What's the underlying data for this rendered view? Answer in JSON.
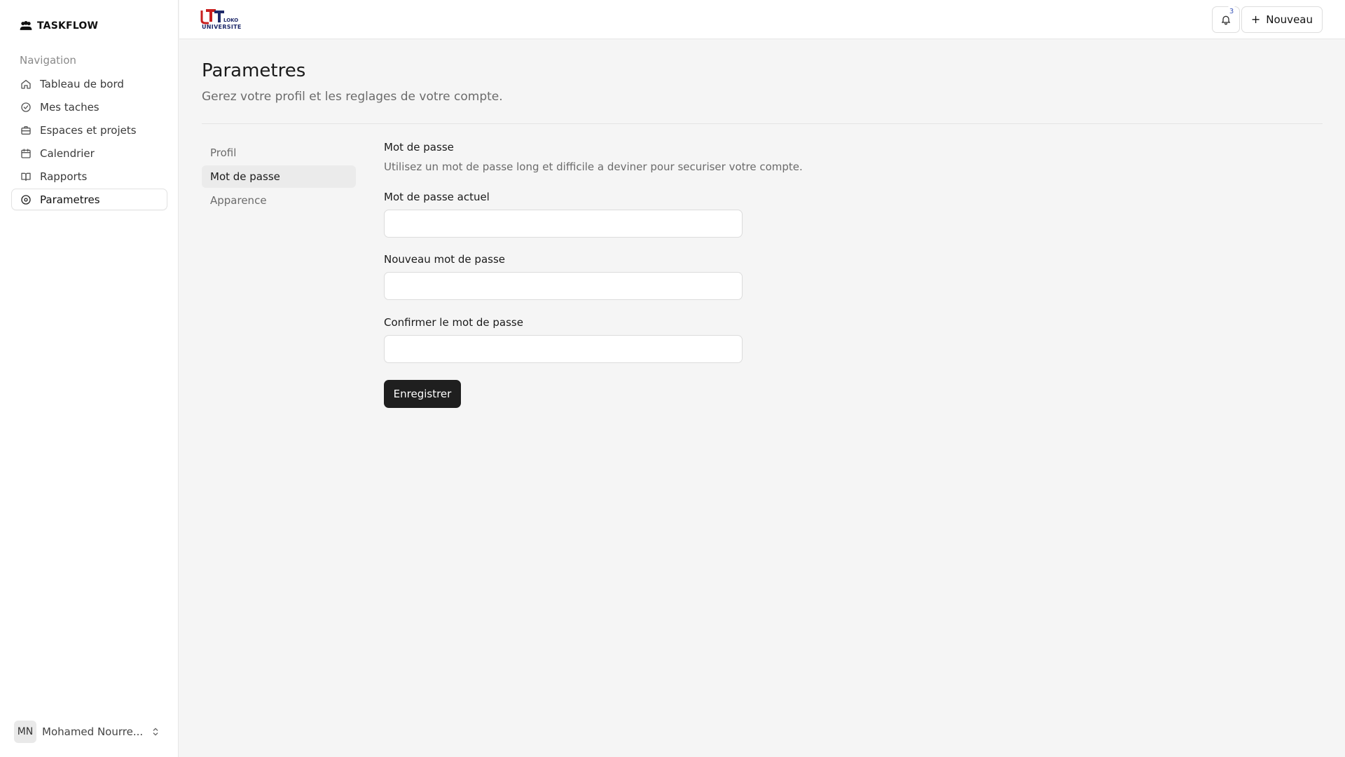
{
  "sidebar": {
    "brand": "TASKFLOW",
    "nav_heading": "Navigation",
    "items": [
      {
        "label": "Tableau de bord",
        "icon": "home-icon"
      },
      {
        "label": "Mes taches",
        "icon": "check-circle-icon"
      },
      {
        "label": "Espaces et projets",
        "icon": "briefcase-icon"
      },
      {
        "label": "Calendrier",
        "icon": "calendar-icon"
      },
      {
        "label": "Rapports",
        "icon": "book-icon"
      },
      {
        "label": "Parametres",
        "icon": "settings-icon",
        "active": true
      }
    ],
    "user": {
      "initials": "MN",
      "name": "Mohamed Nourre..."
    }
  },
  "topbar": {
    "logo_text": "UNIVERSITE",
    "notification_count": "3",
    "new_button_label": "Nouveau"
  },
  "page": {
    "title": "Parametres",
    "subtitle": "Gerez votre profil et les reglages de votre compte."
  },
  "settings_nav": [
    {
      "label": "Profil"
    },
    {
      "label": "Mot de passe",
      "active": true
    },
    {
      "label": "Apparence"
    }
  ],
  "password_section": {
    "title": "Mot de passe",
    "description": "Utilisez un mot de passe long et difficile a deviner pour securiser votre compte.",
    "current_label": "Mot de passe actuel",
    "current_value": "",
    "new_label": "Nouveau mot de passe",
    "new_value": "",
    "confirm_label": "Confirmer le mot de passe",
    "confirm_value": "",
    "save_label": "Enregistrer"
  },
  "colors": {
    "background": "#f5f5f5",
    "primary_button": "#1f1f1f",
    "logo_red": "#c81e1e",
    "logo_navy": "#1f2a6a"
  }
}
